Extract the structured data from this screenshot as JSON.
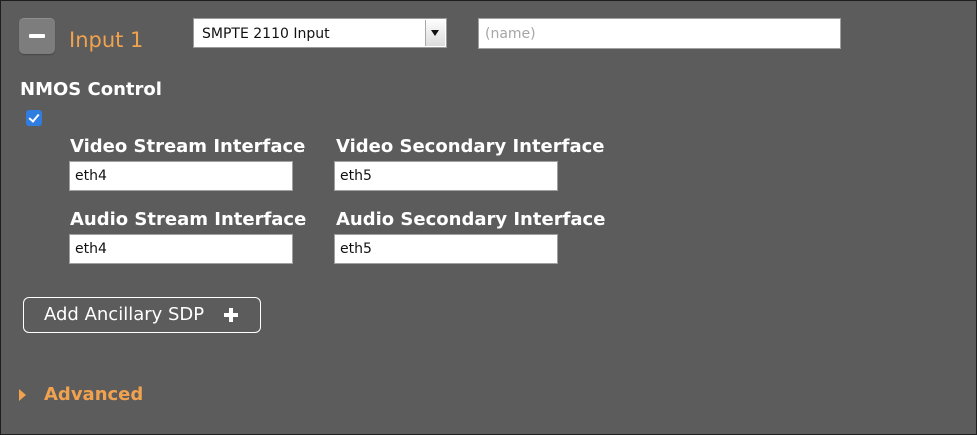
{
  "header": {
    "input_title": "Input 1",
    "type_select": {
      "value": "SMPTE 2110 Input"
    },
    "name_input": {
      "value": "",
      "placeholder": "(name)"
    }
  },
  "nmos": {
    "label": "NMOS Control",
    "checked": true
  },
  "interfaces": {
    "video_stream": {
      "label": "Video Stream Interface",
      "value": "eth4"
    },
    "video_secondary": {
      "label": "Video Secondary Interface",
      "value": "eth5"
    },
    "audio_stream": {
      "label": "Audio Stream Interface",
      "value": "eth4"
    },
    "audio_secondary": {
      "label": "Audio Secondary Interface",
      "value": "eth5"
    }
  },
  "ancillary_button": {
    "label": "Add Ancillary SDP"
  },
  "advanced": {
    "label": "Advanced"
  },
  "colors": {
    "panel_background": "#5c5c5c",
    "accent_orange": "#f0a24e",
    "checkbox_blue": "#2f7de1"
  },
  "icons": {
    "remove": "minus-icon",
    "select_arrow": "dropdown-arrow-icon",
    "checkbox": "checkmark-icon",
    "add": "plus-icon",
    "expand": "triangle-right-icon"
  }
}
